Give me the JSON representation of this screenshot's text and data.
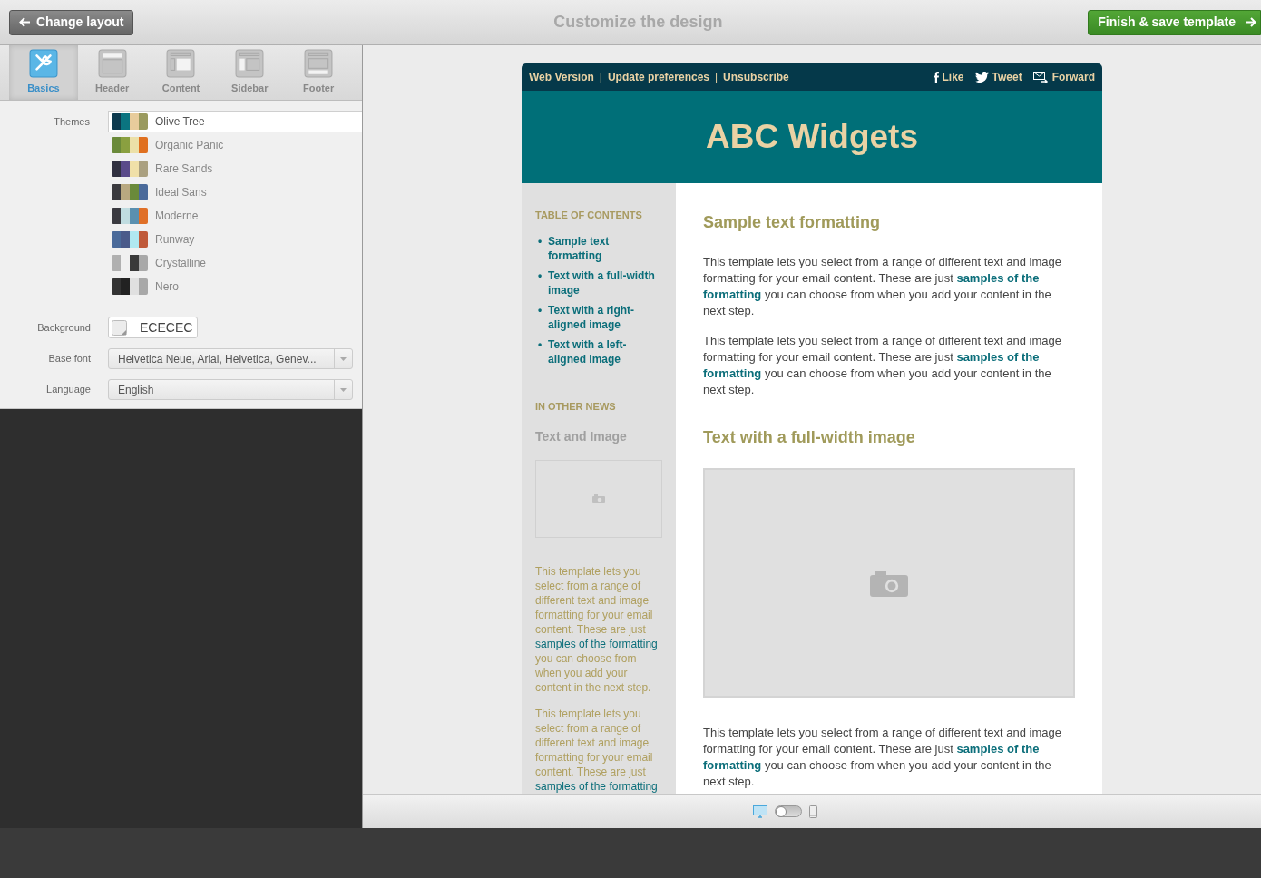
{
  "topbar": {
    "back_button": "Change layout",
    "title": "Customize the design",
    "finish_button": "Finish & save template"
  },
  "tabs": [
    {
      "label": "Basics",
      "kind": "basics",
      "selected": true
    },
    {
      "label": "Header",
      "kind": "header",
      "selected": false
    },
    {
      "label": "Content",
      "kind": "content",
      "selected": false
    },
    {
      "label": "Sidebar",
      "kind": "sidebar",
      "selected": false
    },
    {
      "label": "Footer",
      "kind": "footer",
      "selected": false
    }
  ],
  "themes": {
    "label": "Themes",
    "items": [
      {
        "name": "Olive Tree",
        "selected": true,
        "swatches": [
          {
            "color": "#0d3a4e"
          },
          {
            "color": "#0b7480"
          },
          {
            "color": "#e8cc9c"
          },
          {
            "color": "#9a9a5e"
          }
        ]
      },
      {
        "name": "Organic Panic",
        "selected": false,
        "swatches": [
          {
            "color": "#6a8a3a"
          },
          {
            "color": "#8aa040"
          },
          {
            "color": "#ece0a8"
          },
          {
            "color": "#e07020"
          }
        ]
      },
      {
        "name": "Rare Sands",
        "selected": false,
        "swatches": [
          {
            "color": "#303040"
          },
          {
            "color": "#5a4a8a"
          },
          {
            "color": "#f0e0a8"
          },
          {
            "color": "#aaa080"
          }
        ]
      },
      {
        "name": "Ideal Sans",
        "selected": false,
        "swatches": [
          {
            "color": "#3a3a3e"
          },
          {
            "color": "#b8a880"
          },
          {
            "color": "#6a8a3a"
          },
          {
            "color": "#4a6a9a"
          }
        ]
      },
      {
        "name": "Moderne",
        "selected": false,
        "swatches": [
          {
            "color": "#3a3a40"
          },
          {
            "color": "#c0dce0"
          },
          {
            "color": "#5a90b0"
          },
          {
            "color": "#e07028"
          }
        ]
      },
      {
        "name": "Runway",
        "selected": false,
        "swatches": [
          {
            "color": "#4a6a9a"
          },
          {
            "color": "#4a5a8a"
          },
          {
            "color": "#b0e8f0"
          },
          {
            "color": "#c05a3a"
          }
        ]
      },
      {
        "name": "Crystalline",
        "selected": false,
        "swatches": [
          {
            "color": "#b0b0b0"
          },
          {
            "color": "#f0f0f0"
          },
          {
            "color": "#3a3a3a"
          },
          {
            "color": "#a8a8a8"
          }
        ]
      },
      {
        "name": "Nero",
        "selected": false,
        "swatches": [
          {
            "color": "#333333"
          },
          {
            "color": "#222222"
          },
          {
            "color": "#e0e0e0"
          },
          {
            "color": "#a8a8a8"
          }
        ]
      }
    ]
  },
  "settings": [
    {
      "kind": "color",
      "label": "Background",
      "value": "ECECEC"
    },
    {
      "kind": "select",
      "label": "Base font",
      "value": "Helvetica Neue, Arial, Helvetica, Genev..."
    },
    {
      "kind": "select",
      "label": "Language",
      "value": "English"
    }
  ],
  "email": {
    "links": [
      {
        "label": "Web Version"
      },
      {
        "separator": "|",
        "label": "Update preferences"
      },
      {
        "separator": "|",
        "label": "Unsubscribe"
      }
    ],
    "social": [
      {
        "kind": "facebook",
        "label": "Like"
      },
      {
        "kind": "twitter",
        "label": "Tweet"
      },
      {
        "kind": "forward",
        "label": "Forward"
      }
    ],
    "title": "ABC Widgets",
    "sidebar": {
      "toc_heading": "TABLE OF CONTENTS",
      "toc": [
        {
          "bullet": "•",
          "label": "Sample text formatting"
        },
        {
          "bullet": "•",
          "label": "Text with a full-width image"
        },
        {
          "bullet": "•",
          "label": "Text with a right-aligned image"
        },
        {
          "bullet": "•",
          "label": "Text with a left-aligned image"
        }
      ],
      "news_heading": "IN OTHER NEWS",
      "news_title": "Text and Image",
      "paragraphs": [
        "This template lets you select from a range of different text and image formatting for your email content. These are just **samples of the formatting** you can choose from when you add your content in the next step.",
        "This template lets you select from a range of different text and image formatting for your email content. These are just **samples of the formatting**"
      ]
    },
    "sections": [
      {
        "heading": "Sample text formatting",
        "kind": "text",
        "paragraphs": [
          "This template lets you select from a range of different text and image formatting for your email content. These are just **samples of the formatting** you can choose from when you add your content in the next step.",
          "This template lets you select from a range of different text and image formatting for your email content. These are just **samples of the formatting** you can choose from when you add your content in the next step."
        ]
      },
      {
        "heading": "Text with a full-width image",
        "kind": "image",
        "paragraphs": [
          "This template lets you select from a range of different text and image formatting for your email content. These are just **samples of the formatting** you can choose from when you add your content in the next step."
        ]
      }
    ]
  },
  "preview_modes": [
    {
      "kind": "desktop",
      "selected": true
    },
    {
      "kind": "mobile",
      "selected": false
    }
  ]
}
